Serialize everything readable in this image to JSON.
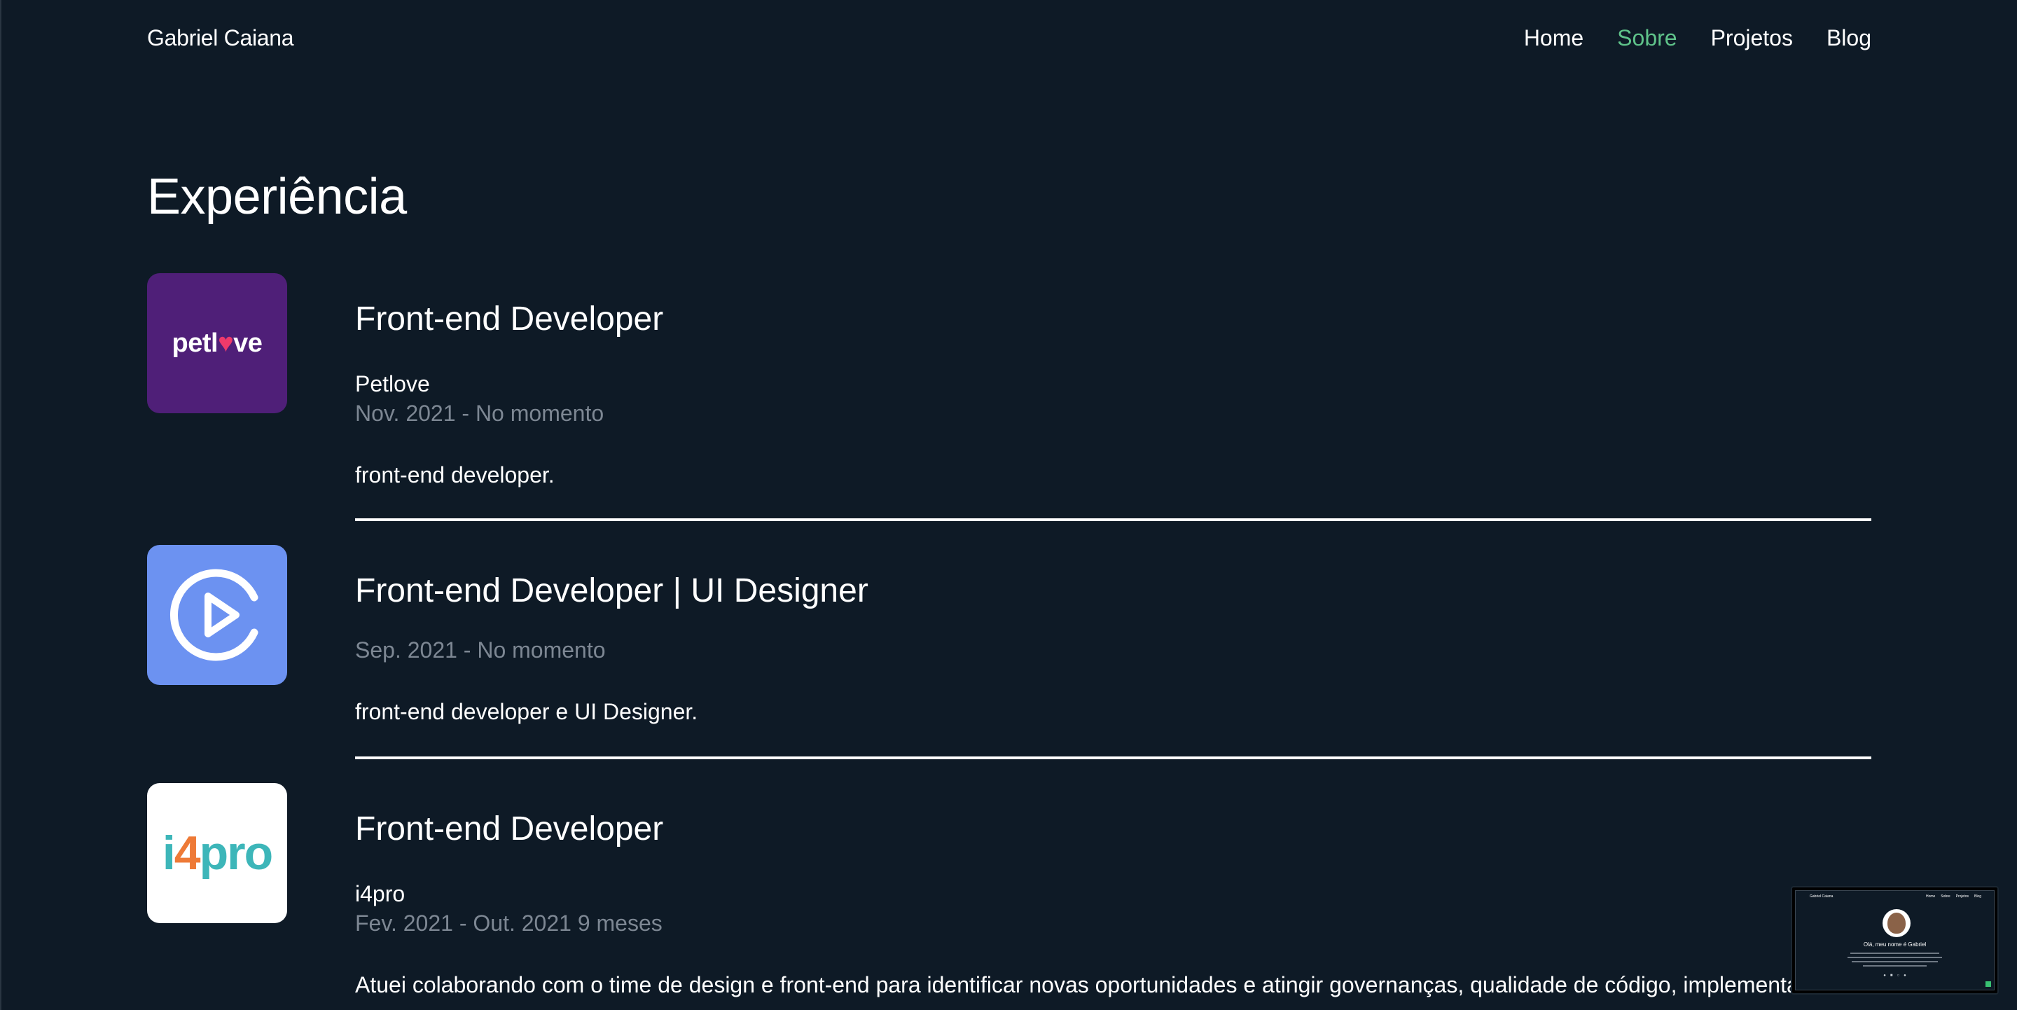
{
  "header": {
    "brand": "Gabriel Caiana",
    "nav": [
      {
        "label": "Home",
        "active": false
      },
      {
        "label": "Sobre",
        "active": true
      },
      {
        "label": "Projetos",
        "active": false
      },
      {
        "label": "Blog",
        "active": false
      }
    ]
  },
  "section_title": "Experiência",
  "experiences": [
    {
      "logo": "petlove-logo",
      "logo_text": "petlove",
      "role": "Front-end Developer",
      "company": "Petlove",
      "period": "Nov. 2021 - No momento",
      "description": "front-end developer."
    },
    {
      "logo": "play-icon",
      "role": "Front-end Developer | UI Designer",
      "company": "",
      "period": "Sep. 2021 - No momento",
      "description": "front-end developer e UI Designer."
    },
    {
      "logo": "i4pro-logo",
      "logo_text": "i4pro",
      "role": "Front-end Developer",
      "company": "i4pro",
      "period": "Fev. 2021 - Out. 2021 9 meses",
      "description": "Atuei colaborando com o time de design e front-end para identificar novas oportunidades e atingir governanças, qualidade de código, implementa"
    }
  ],
  "preview": {
    "brand": "Gabriel Caiana",
    "nav": [
      "Home",
      "Sobre",
      "Projetos",
      "Blog"
    ],
    "title": "Olá, meu nome é Gabriel"
  },
  "colors": {
    "background": "#0e1a26",
    "accent": "#5fc38a",
    "muted": "#7d8793",
    "petlove_bg": "#4f1f78",
    "play_bg": "#6c92f1"
  }
}
